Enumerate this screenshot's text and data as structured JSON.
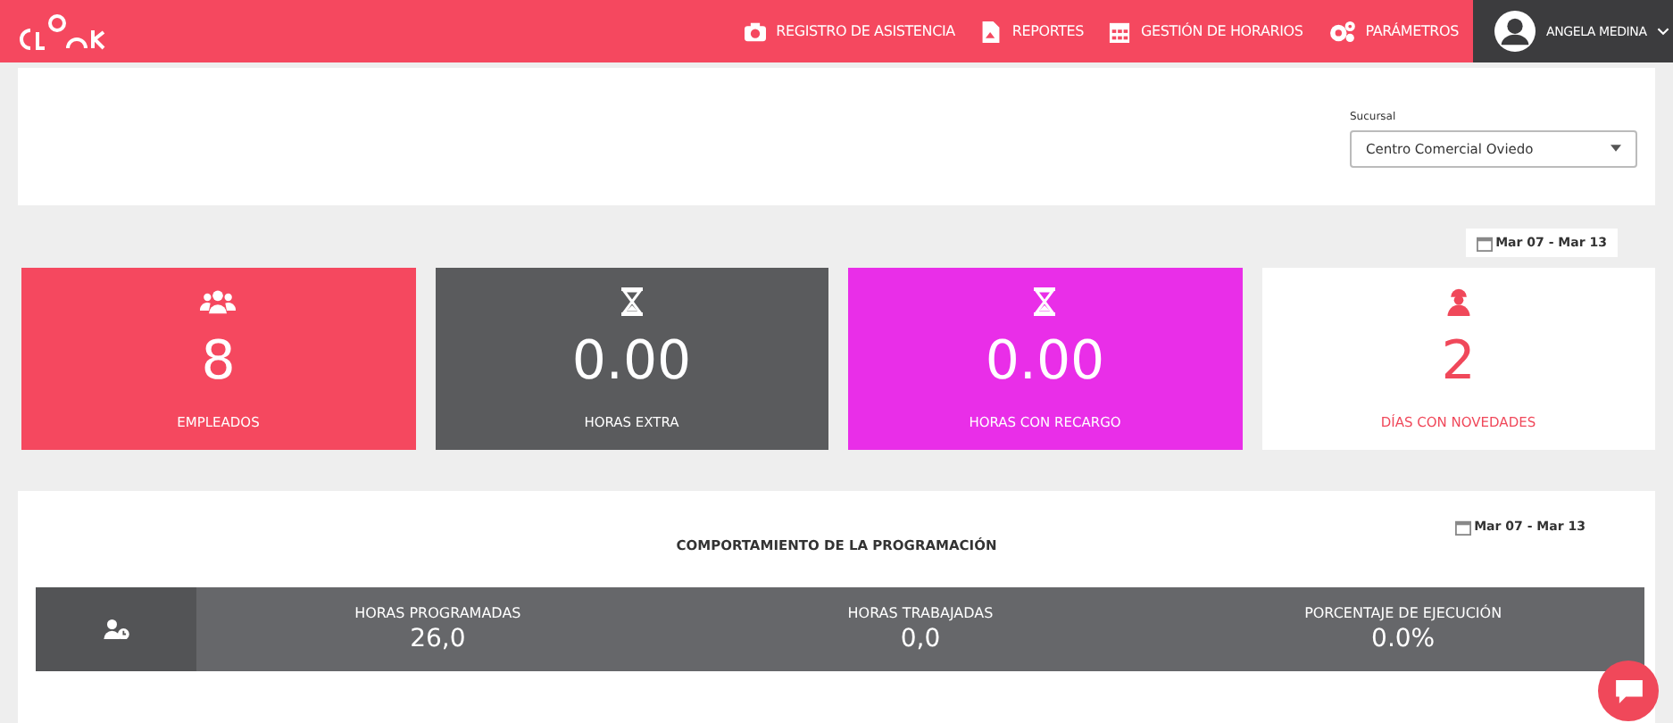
{
  "nav": [
    {
      "kind": "camera",
      "label": "REGISTRO DE ASISTENCIA"
    },
    {
      "kind": "file",
      "label": "REPORTES"
    },
    {
      "kind": "calendar",
      "label": "GESTIÓN DE HORARIOS"
    },
    {
      "kind": "gears",
      "label": "PARÁMETROS"
    }
  ],
  "user": {
    "name": "ANGELA MEDINA"
  },
  "filter": {
    "label": "Sucursal",
    "value": "Centro Comercial Oviedo"
  },
  "date_range": "Mar 07 - Mar 13",
  "cards": [
    {
      "kind": "users",
      "value": "8",
      "label": "EMPLEADOS",
      "outlined": false,
      "color": "#f5485f"
    },
    {
      "kind": "hourglass",
      "value": "0.00",
      "label": "HORAS EXTRA",
      "outlined": false,
      "color": "#5a5b5d"
    },
    {
      "kind": "hourglass",
      "value": "0.00",
      "label": "HORAS CON RECARGO",
      "outlined": false,
      "color": "#e92ee8"
    },
    {
      "kind": "worker",
      "value": "2",
      "label": "DÍAS CON NOVEDADES",
      "outlined": true,
      "color": "#f0485a"
    }
  ],
  "schedule": {
    "date_range": "Mar 07 - Mar 13",
    "title": "COMPORTAMIENTO DE LA PROGRAMACIÓN",
    "stats": [
      {
        "label": "HORAS PROGRAMADAS",
        "value": "26,0"
      },
      {
        "label": "HORAS TRABAJADAS",
        "value": "0,0"
      },
      {
        "label": "PORCENTAJE DE EJECUCIÓN",
        "value": "0.0%"
      }
    ]
  }
}
